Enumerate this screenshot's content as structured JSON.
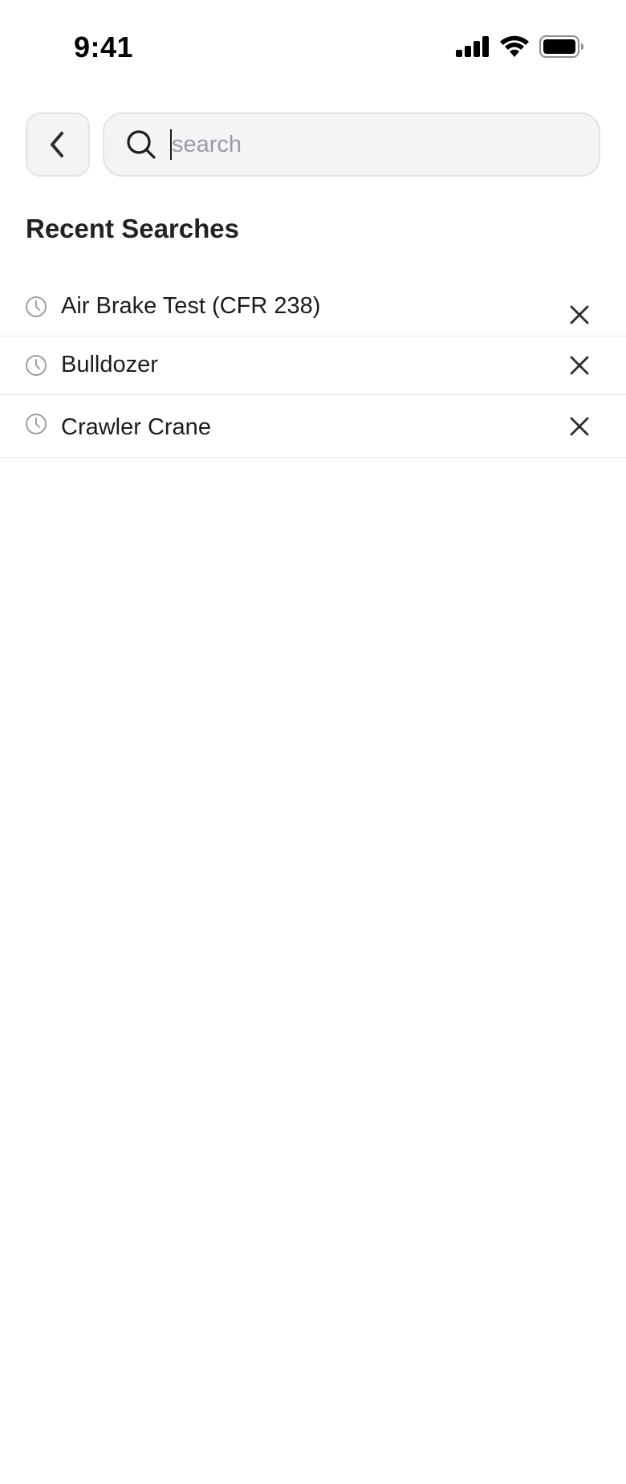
{
  "status_bar": {
    "time": "9:41",
    "icons": [
      "cellular-signal-icon",
      "wifi-icon",
      "battery-icon"
    ]
  },
  "header": {
    "back_icon": "chevron-left-icon",
    "search": {
      "placeholder": "search",
      "value": "",
      "icon": "search-icon"
    }
  },
  "recent": {
    "title": "Recent Searches",
    "items": [
      {
        "label": "Air Brake Test (CFR 238)",
        "icon": "clock-icon",
        "action_icon": "close-icon"
      },
      {
        "label": "Bulldozer",
        "icon": "clock-icon",
        "action_icon": "close-icon"
      },
      {
        "label": "Crawler Crane",
        "icon": "clock-icon",
        "action_icon": "close-icon"
      }
    ]
  },
  "colors": {
    "background": "#ffffff",
    "field_background": "#f3f4f6",
    "field_border": "#e3e4e7",
    "text_primary": "#1c1c1e",
    "placeholder": "#9a9ca3",
    "divider": "#e6e7ea",
    "clock_icon": "#a0a0a5"
  }
}
